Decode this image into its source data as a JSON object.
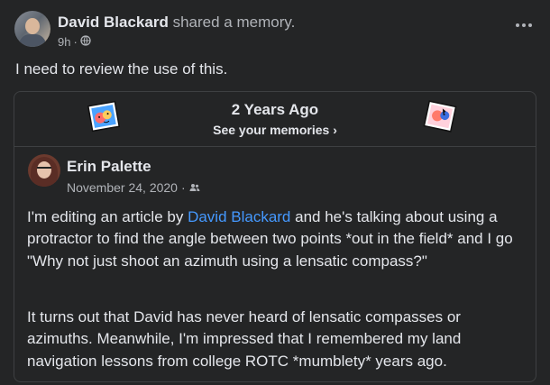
{
  "post": {
    "author": "David Blackard",
    "action": "shared a memory.",
    "time": "9h",
    "dot": "·",
    "text": "I need to review the use of this."
  },
  "memory": {
    "title": "2 Years Ago",
    "link_label": "See your memories",
    "chevron": "›"
  },
  "shared_post": {
    "author": "Erin Palette",
    "date": "November 24, 2020",
    "dot": "·",
    "para1_before": "I'm editing an article by ",
    "para1_link": "David Blackard",
    "para1_after": " and he's talking about using a protractor to find the angle between two points *out in the field* and I go \"Why not just shoot an azimuth using a lensatic compass?\"",
    "para2": "It turns out that David has never heard of lensatic compasses or azimuths. Meanwhile, I'm impressed that I remembered my land navigation lessons from college ROTC *mumblety* years ago."
  },
  "icons": {
    "privacy": "globe-icon",
    "audience": "friends-icon",
    "more": "more-options-icon",
    "sticker_left": "memory-sticker-icon",
    "sticker_right": "memory-sticker-icon"
  },
  "colors": {
    "background": "#242526",
    "text": "#e4e6eb",
    "secondary_text": "#b0b3b8",
    "link": "#4599ff",
    "divider": "#3e4042"
  }
}
